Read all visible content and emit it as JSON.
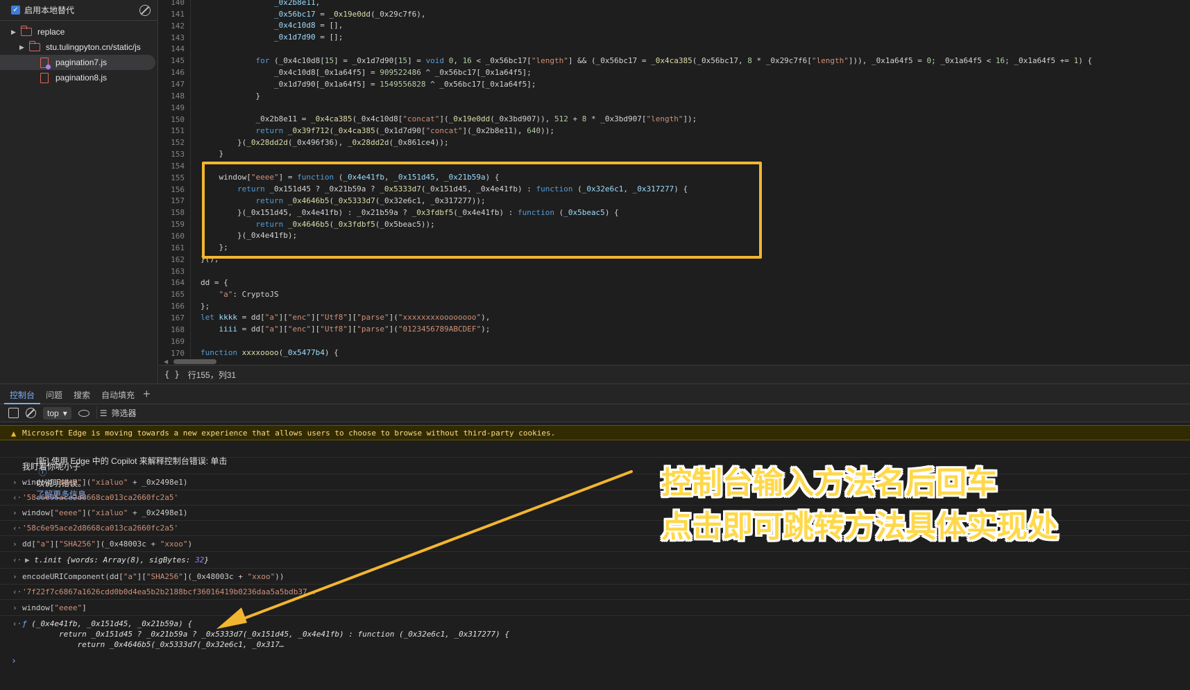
{
  "sidebar": {
    "overrides_label": "启用本地替代",
    "tree": [
      {
        "label": "replace"
      },
      {
        "label": "stu.tulingpyton.cn/static/js"
      },
      {
        "label": "pagination7.js"
      },
      {
        "label": "pagination8.js"
      }
    ]
  },
  "editor": {
    "line_numbers": [
      "140",
      "141",
      "142",
      "143",
      "144",
      "145",
      "146",
      "147",
      "148",
      "149",
      "150",
      "151",
      "152",
      "153",
      "154",
      "155",
      "156",
      "157",
      "158",
      "159",
      "160",
      "161",
      "162",
      "163",
      "164",
      "165",
      "166",
      "167",
      "168",
      "169",
      "170"
    ],
    "status": {
      "braces": "{ }",
      "position": "行155，列31"
    }
  },
  "drawer": {
    "tabs": [
      "控制台",
      "问题",
      "搜索",
      "自动填充"
    ],
    "context": "top",
    "filter_label": "筛选器"
  },
  "console": {
    "warning": "Microsoft Edge is moving towards a new experience that allows users to choose to browse without third-party cookies.",
    "copilot_prefix": "[新] 使用 Edge 中的 Copilot 来解释控制台错误: 单击",
    "copilot_mid": "以说明错误。",
    "copilot_link": "了解更多信息",
    "log_message": "我盯着你呢小子",
    "entries": [
      {
        "input_a": "window[",
        "input_b": "\"eeee\"",
        "input_c": "](",
        "input_d": "\"xialuo\"",
        "input_e": " + _0x2498e1)",
        "output": "'58c6e95ace2d8668ca013ca2660fc2a5'"
      },
      {
        "input_a": "window[",
        "input_b": "\"eeee\"",
        "input_c": "](",
        "input_d": "\"xialuo\"",
        "input_e": " + _0x2498e1)",
        "output": "'58c6e95ace2d8668ca013ca2660fc2a5'"
      }
    ],
    "sha_input": {
      "a": "dd[",
      "b": "\"a\"",
      "c": "][",
      "d": "\"SHA256\"",
      "e": "](_0x48003c + ",
      "f": "\"xxoo\"",
      "g": ")"
    },
    "sha_output": {
      "name": "t.init",
      "a": " {words: Array(8), sigBytes: ",
      "num": "32",
      "b": "}"
    },
    "encode_input": {
      "a": "encodeURIComponent(dd[",
      "b": "\"a\"",
      "c": "][",
      "d": "\"SHA256\"",
      "e": "](_0x48003c + ",
      "f": "\"xxoo\"",
      "g": "))"
    },
    "encode_output": "'7f22f7c6867a1626cdd0b0d4ea5b2b2188bcf36016419b0236daa5a5bdb37..",
    "fn_input": {
      "a": "window[",
      "b": "\"eeee\"",
      "c": "]"
    },
    "fn_output": {
      "f": "ƒ",
      "line1": " (_0x4e41fb, _0x151d45, _0x21b59a) {",
      "line2": "        return _0x151d45 ? _0x21b59a ? _0x5333d7(_0x151d45, _0x4e41fb) : function (_0x32e6c1, _0x317277) {",
      "line3": "            return _0x4646b5(_0x5333d7(_0x32e6c1, _0x317…"
    },
    "prompt": "›"
  },
  "annotation": {
    "line1": "控制台输入方法名后回车",
    "line2": "点击即可跳转方法具体实现处",
    "color": "#ffd84a",
    "arrow_color": "#f2b630"
  }
}
